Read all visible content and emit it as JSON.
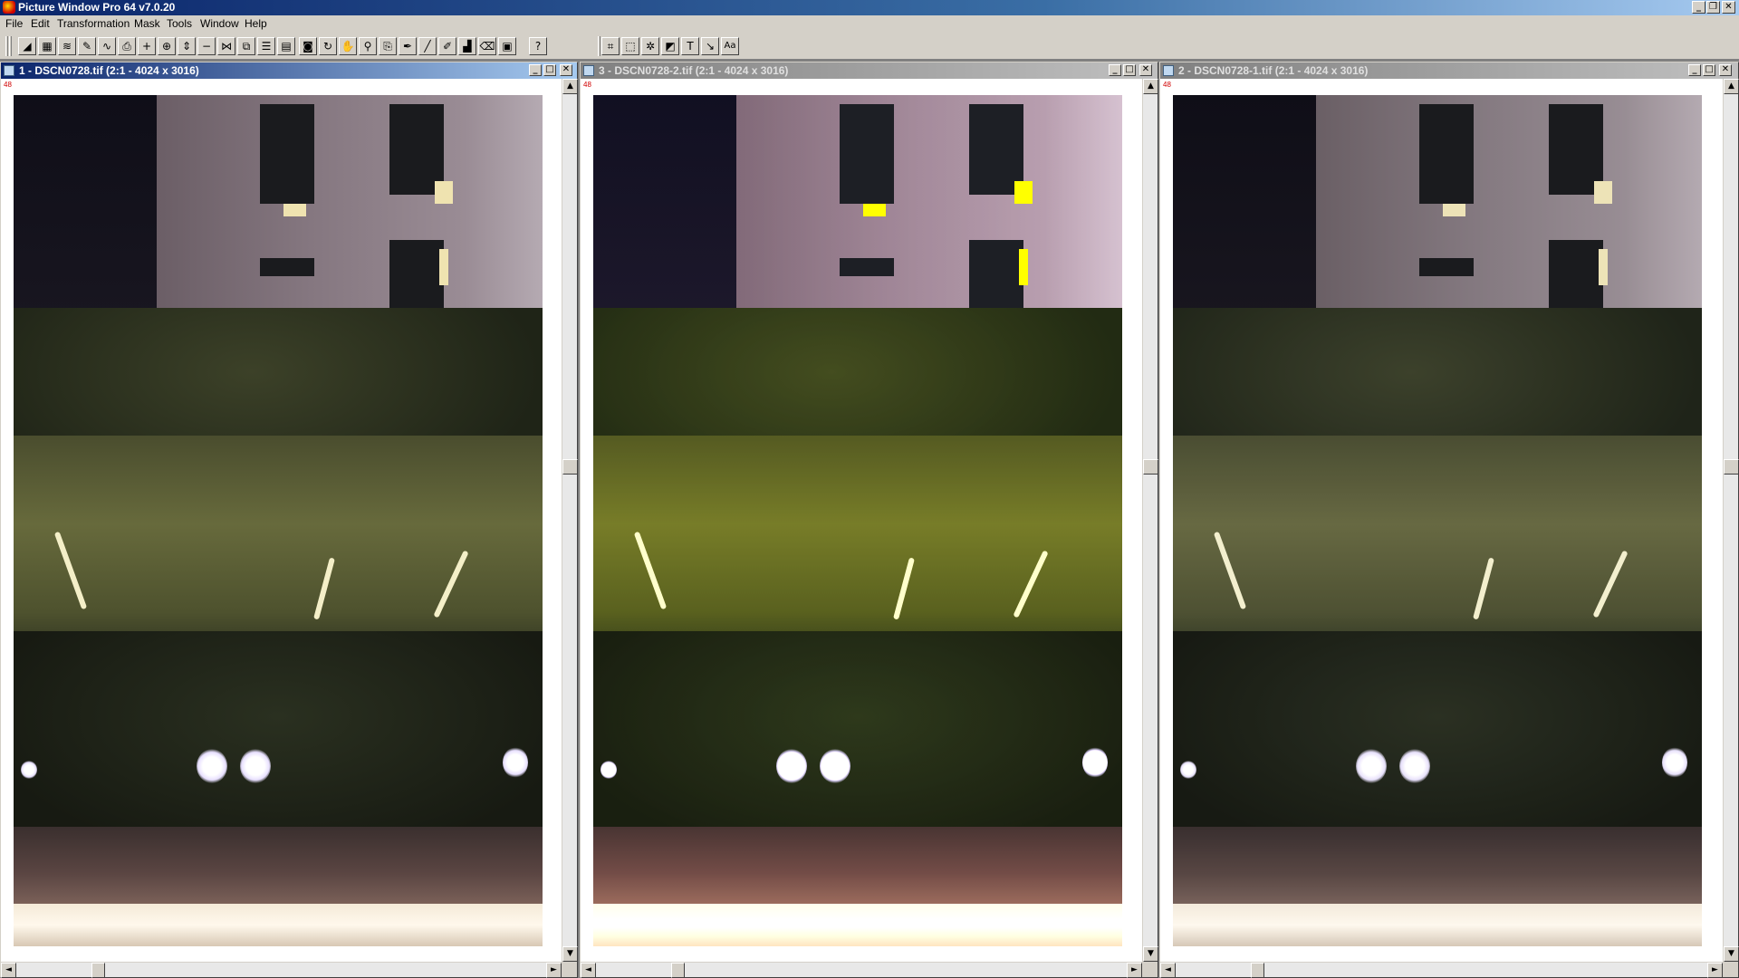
{
  "app": {
    "title": "Picture Window Pro 64  v7.0.20",
    "controls": {
      "minimize": "_",
      "restore": "❐",
      "close": "✕"
    }
  },
  "menu": [
    "File",
    "Edit",
    "Transformation",
    "Mask",
    "Tools",
    "Window",
    "Help"
  ],
  "toolbar": {
    "icons": [
      "levels-icon",
      "grid-icon",
      "wave-icon",
      "brush-icon",
      "curve-icon",
      "print-icon",
      "add-icon",
      "target-icon",
      "resize-icon",
      "minus-icon",
      "split-icon",
      "copy-icon",
      "list-icon",
      "layers-icon",
      "camera-icon",
      "rotate-icon",
      "hand-icon",
      "zoom-icon",
      "clone-icon",
      "pen-icon",
      "line-icon",
      "paint-icon",
      "histogram-icon",
      "eraser-icon",
      "snapshot-icon",
      "help-icon",
      "crop-icon",
      "select-icon",
      "star-icon",
      "gradient-icon",
      "text-tool-icon",
      "arrow-icon",
      "font-icon"
    ],
    "help_glyph": "?",
    "font_glyph": "Aa"
  },
  "windows": [
    {
      "title": "1 - DSCN0728.tif (2:1 - 4024 x 3016)",
      "zoom_tag": "48",
      "active": true
    },
    {
      "title": "3 - DSCN0728-2.tif (2:1 - 4024 x 3016)",
      "zoom_tag": "48",
      "active": false
    },
    {
      "title": "2 - DSCN0728-1.tif (2:1 - 4024 x 3016)",
      "zoom_tag": "48",
      "active": false
    }
  ],
  "window_controls": {
    "minimize": "_",
    "maximize": "□",
    "close": "✕"
  },
  "scroll": {
    "up": "▲",
    "down": "▼",
    "left": "◄",
    "right": "►"
  }
}
